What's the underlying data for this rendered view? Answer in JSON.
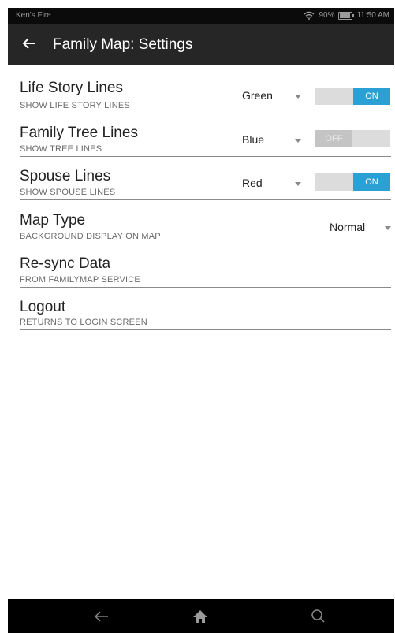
{
  "status_bar": {
    "device_name": "Ken's Fire",
    "battery": "90%",
    "battery_level": 0.9,
    "time": "11:50 AM"
  },
  "app_bar": {
    "title": "Family Map: Settings",
    "back_icon": "arrow-left-icon"
  },
  "settings": [
    {
      "title": "Life Story Lines",
      "subtitle": "SHOW LIFE STORY LINES",
      "color": "Green",
      "toggle": "ON"
    },
    {
      "title": "Family Tree Lines",
      "subtitle": "SHOW TREE LINES",
      "color": "Blue",
      "toggle": "OFF"
    },
    {
      "title": "Spouse Lines",
      "subtitle": "SHOW SPOUSE LINES",
      "color": "Red",
      "toggle": "ON"
    },
    {
      "title": "Map Type",
      "subtitle": "BACKGROUND DISPLAY ON MAP",
      "map_type": "Normal"
    },
    {
      "title": "Re-sync Data",
      "subtitle": "FROM FAMILYMAP SERVICE"
    },
    {
      "title": "Logout",
      "subtitle": "RETURNS TO LOGIN SCREEN"
    }
  ],
  "nav_bar": {
    "icons": [
      "back-icon",
      "home-icon",
      "search-icon"
    ]
  },
  "colors": {
    "toggle_on": "#2aa0d4",
    "app_bar": "#262626",
    "status_bar": "#0b0b0b"
  }
}
